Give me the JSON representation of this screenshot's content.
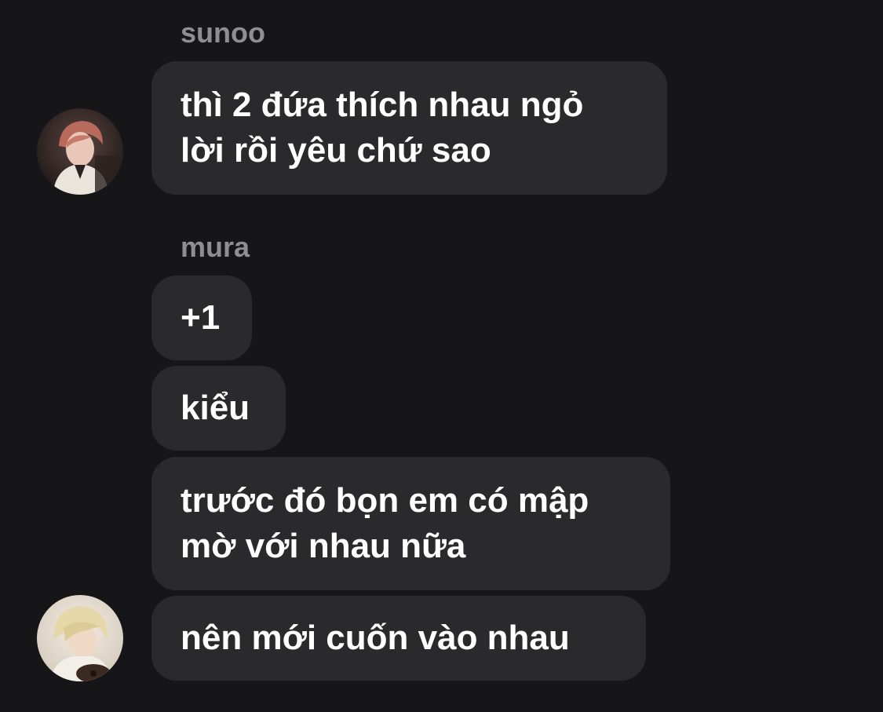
{
  "messages": [
    {
      "sender": "sunoo",
      "bubbles": [
        {
          "lines": [
            "thì 2 đứa thích nhau ngỏ",
            "lời rồi yêu chứ sao"
          ]
        }
      ]
    },
    {
      "sender": "mura",
      "bubbles": [
        {
          "lines": [
            "+1"
          ]
        },
        {
          "lines": [
            "kiểu"
          ]
        },
        {
          "lines": [
            "trước đó bọn em có mập",
            "mờ với nhau nữa"
          ]
        },
        {
          "lines": [
            "nên mới cuốn vào nhau"
          ]
        }
      ]
    }
  ],
  "avatars": [
    {
      "name": "sunoo",
      "icon": "user-avatar-photo"
    },
    {
      "name": "mura",
      "icon": "user-avatar-photo"
    }
  ],
  "colors": {
    "background": "#161618",
    "bubble": "#2a2a2c",
    "text": "#ffffff",
    "sender_name": "#8e8e93"
  }
}
